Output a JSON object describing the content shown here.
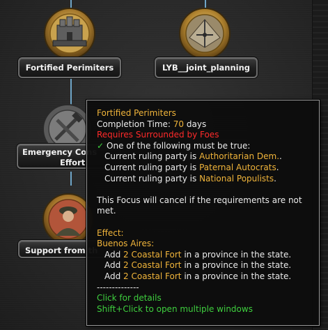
{
  "focus_nodes": [
    {
      "label": "Fortified Perimiters",
      "icon": "fortress-icon"
    },
    {
      "label": "LYB__joint_planning",
      "icon": "map-planning-icon"
    },
    {
      "label": "Emergency Cons",
      "label2": "Effort",
      "icon": "construction-tools-icon"
    },
    {
      "label": "Support from th",
      "icon": "soldier-portrait-icon"
    }
  ],
  "tooltip": {
    "title": "Fortified Perimiters",
    "completion_prefix": "Completion Time: ",
    "completion_value": "70",
    "completion_suffix": " days",
    "requires": "Requires Surrounded by Foes",
    "one_of": "One of the following must be true:",
    "conditions": [
      {
        "prefix": "Current ruling party is ",
        "value": "Authoritarian Dem.",
        "suffix": "."
      },
      {
        "prefix": "Current ruling party is ",
        "value": "Paternal Autocrats",
        "suffix": "."
      },
      {
        "prefix": "Current ruling party is ",
        "value": "National Populists",
        "suffix": "."
      }
    ],
    "cancel_line1": "This Focus will cancel if the requirements are not",
    "cancel_line2": "met.",
    "effect_label": "Effect:",
    "state_label": "Buenos Aires:",
    "effects": [
      {
        "prefix": "Add ",
        "amount": "2",
        "building": "Coastal Fort",
        "suffix": " in a province in the state."
      },
      {
        "prefix": "Add ",
        "amount": "2",
        "building": "Coastal Fort",
        "suffix": " in a province in the state."
      },
      {
        "prefix": "Add ",
        "amount": "2",
        "building": "Coastal Fort",
        "suffix": " in a province in the state."
      }
    ],
    "separator": "--------------",
    "click_details": "Click for details",
    "shift_click": "Shift+Click to open multiple windows"
  },
  "colors": {
    "highlight": "#f0b43a",
    "warning": "#ff2a2a",
    "hint": "#3ecf3e",
    "connector": "#6fa6c8"
  }
}
